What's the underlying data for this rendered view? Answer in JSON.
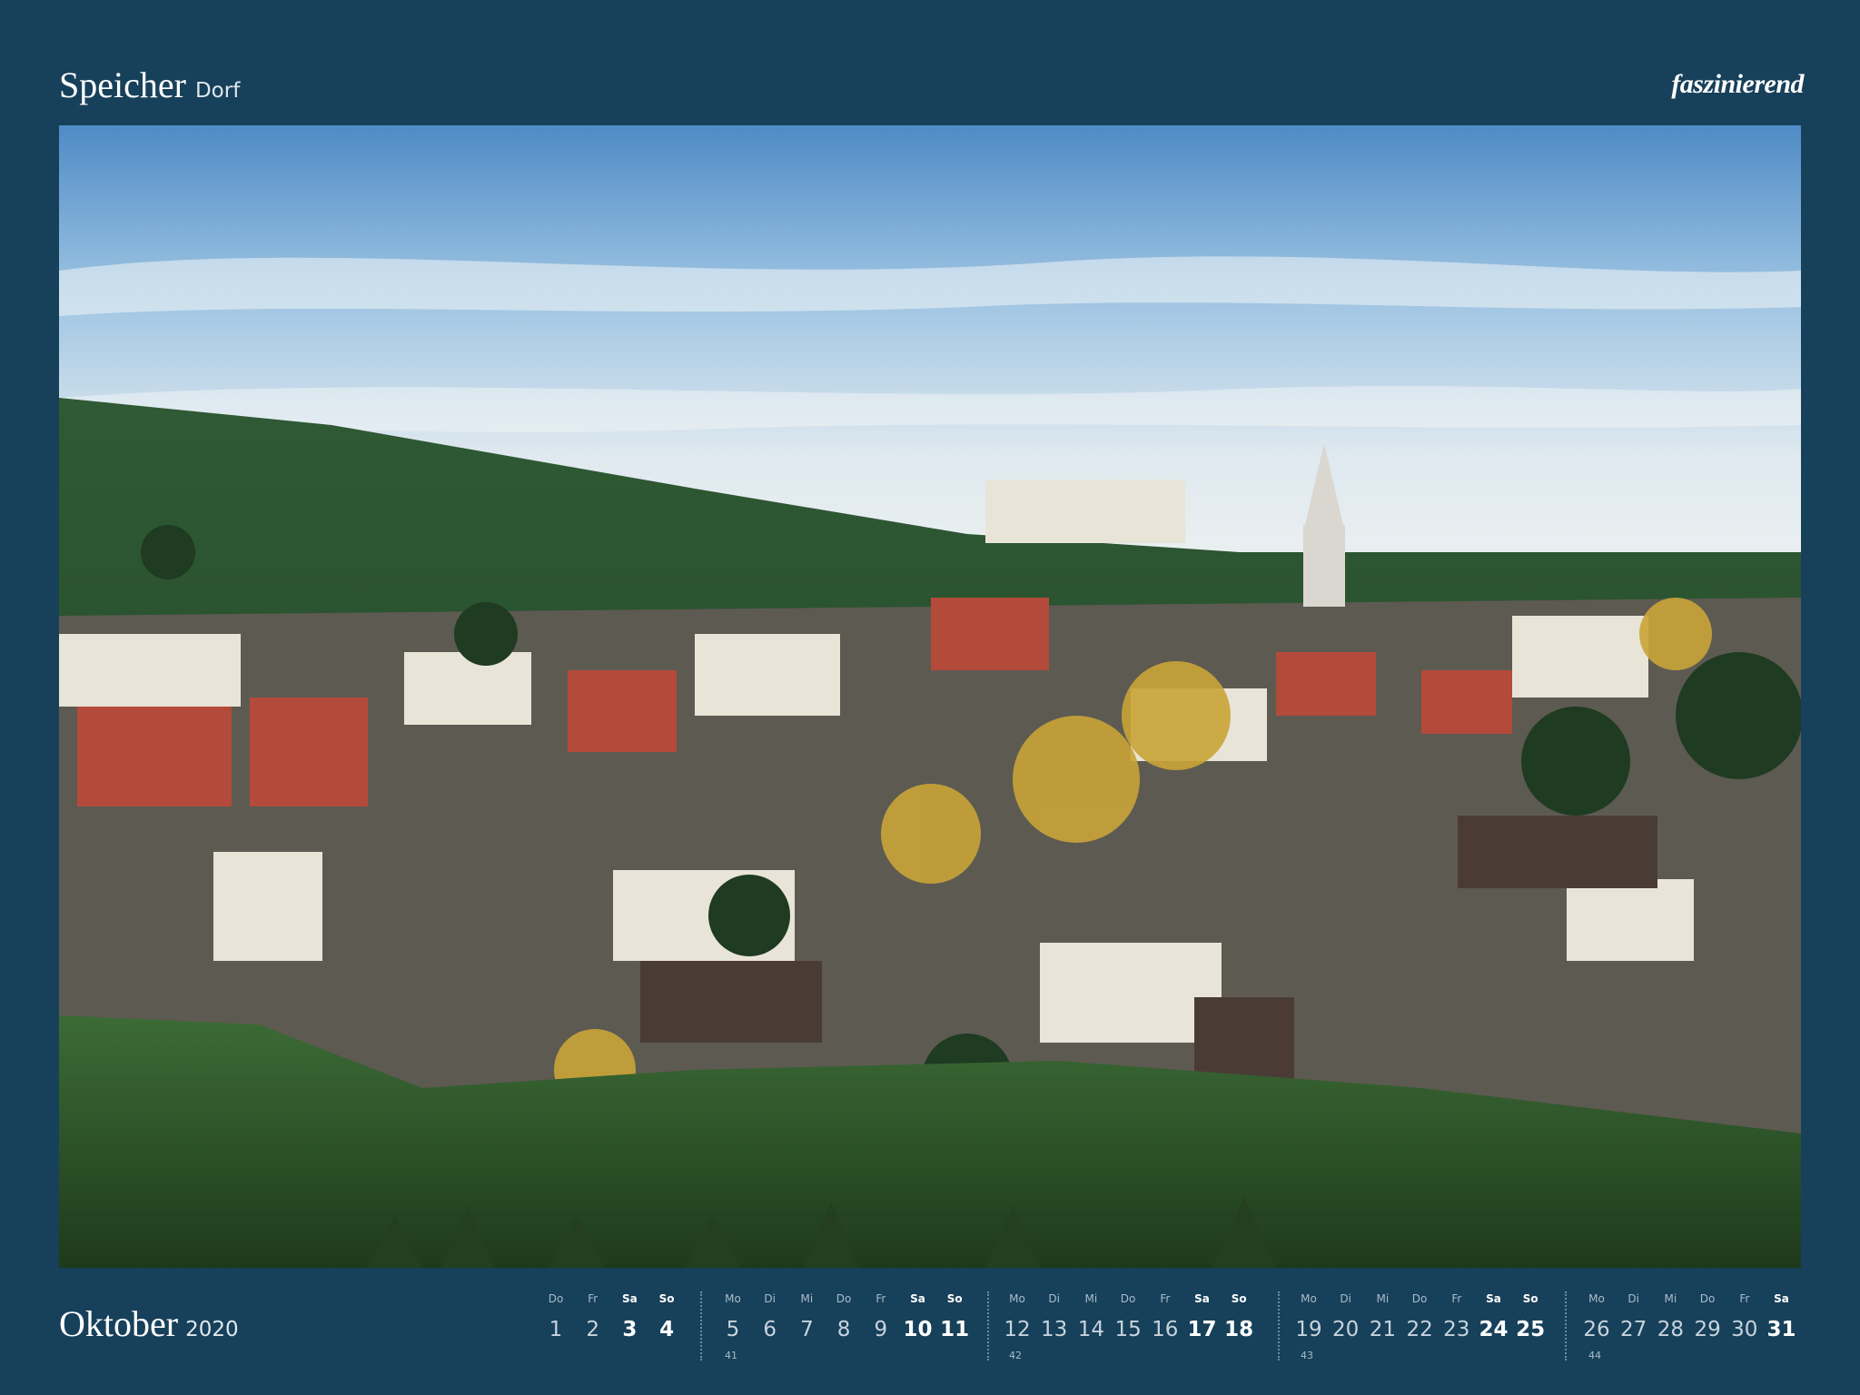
{
  "header": {
    "place": "Speicher",
    "subtitle": "Dorf",
    "brand": "faszinierend"
  },
  "footer": {
    "month": "Oktober",
    "year": "2020"
  },
  "calendar": {
    "weeks": [
      {
        "kw": "",
        "days": [
          {
            "dn": "Do",
            "d": "1"
          },
          {
            "dn": "Fr",
            "d": "2"
          },
          {
            "dn": "Sa",
            "d": "3"
          },
          {
            "dn": "So",
            "d": "4"
          }
        ]
      },
      {
        "kw": "41",
        "days": [
          {
            "dn": "Mo",
            "d": "5"
          },
          {
            "dn": "Di",
            "d": "6"
          },
          {
            "dn": "Mi",
            "d": "7"
          },
          {
            "dn": "Do",
            "d": "8"
          },
          {
            "dn": "Fr",
            "d": "9"
          },
          {
            "dn": "Sa",
            "d": "10"
          },
          {
            "dn": "So",
            "d": "11"
          }
        ]
      },
      {
        "kw": "42",
        "days": [
          {
            "dn": "Mo",
            "d": "12"
          },
          {
            "dn": "Di",
            "d": "13"
          },
          {
            "dn": "Mi",
            "d": "14"
          },
          {
            "dn": "Do",
            "d": "15"
          },
          {
            "dn": "Fr",
            "d": "16"
          },
          {
            "dn": "Sa",
            "d": "17"
          },
          {
            "dn": "So",
            "d": "18"
          }
        ]
      },
      {
        "kw": "43",
        "days": [
          {
            "dn": "Mo",
            "d": "19"
          },
          {
            "dn": "Di",
            "d": "20"
          },
          {
            "dn": "Mi",
            "d": "21"
          },
          {
            "dn": "Do",
            "d": "22"
          },
          {
            "dn": "Fr",
            "d": "23"
          },
          {
            "dn": "Sa",
            "d": "24"
          },
          {
            "dn": "So",
            "d": "25"
          }
        ]
      },
      {
        "kw": "44",
        "days": [
          {
            "dn": "Mo",
            "d": "26"
          },
          {
            "dn": "Di",
            "d": "27"
          },
          {
            "dn": "Mi",
            "d": "28"
          },
          {
            "dn": "Do",
            "d": "29"
          },
          {
            "dn": "Fr",
            "d": "30"
          },
          {
            "dn": "Sa",
            "d": "31"
          }
        ]
      }
    ]
  },
  "colors": {
    "background": "#17405a",
    "weekend": "#ffffff",
    "weekday": "#c7d3dd"
  }
}
